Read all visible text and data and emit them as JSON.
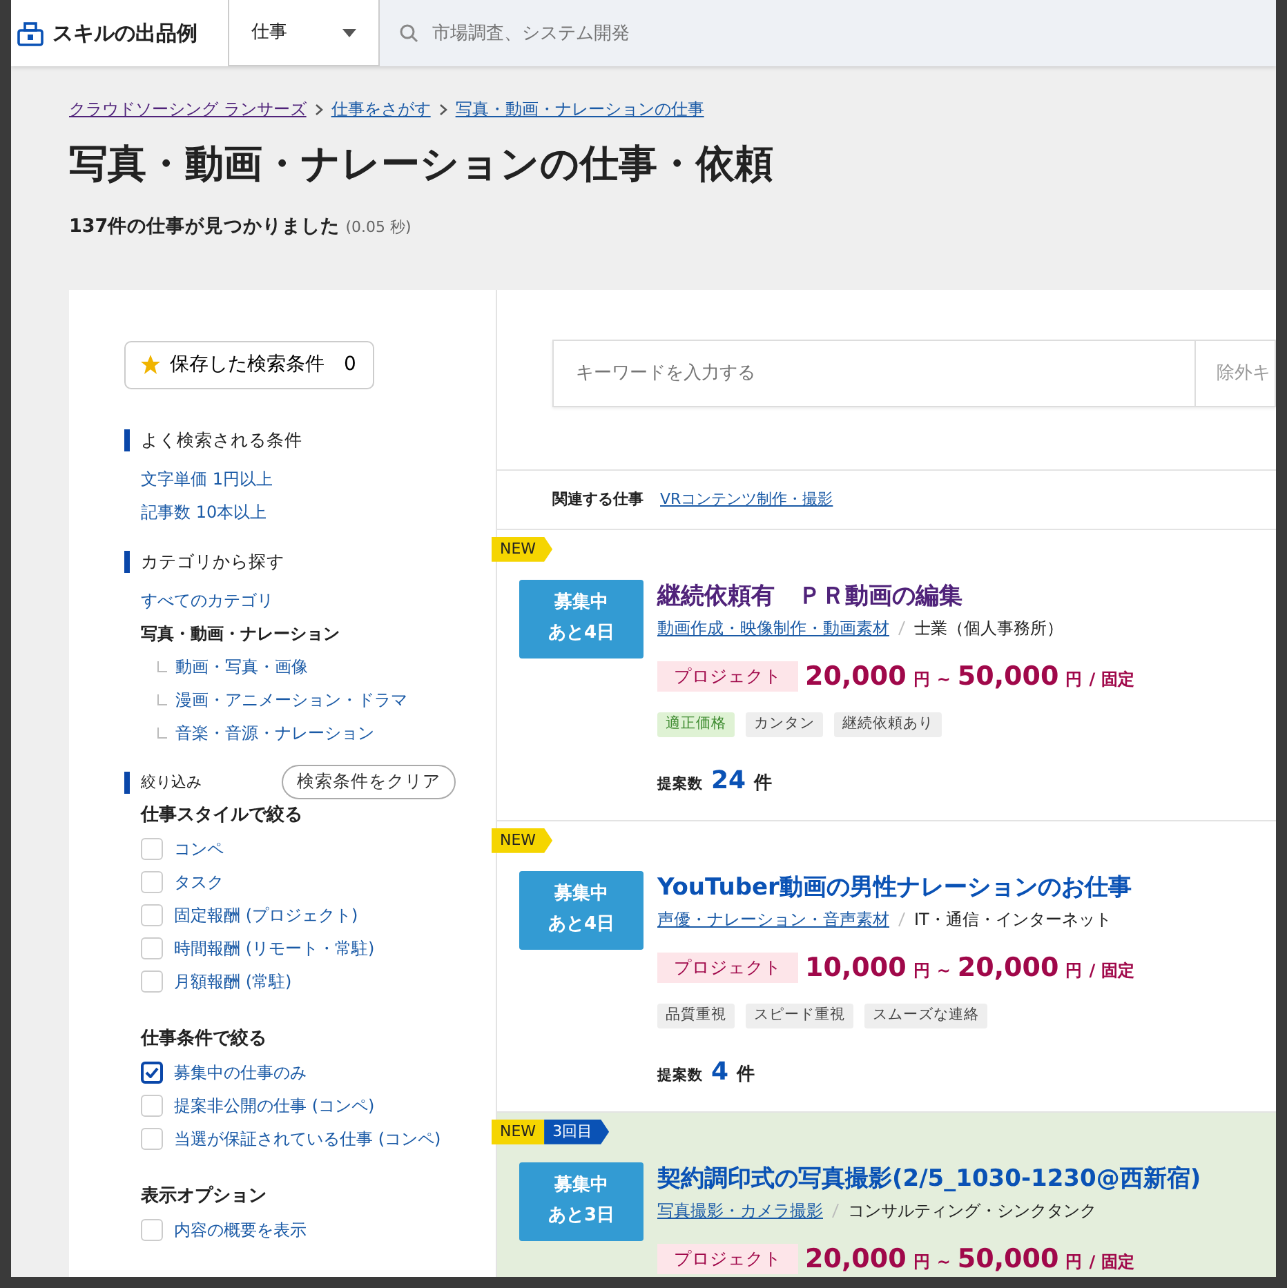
{
  "header": {
    "logo_text": "スキルの出品例",
    "category_select": "仕事",
    "search_placeholder": "市場調査、システム開発"
  },
  "breadcrumbs": [
    {
      "label": "クラウドソーシング ランサーズ",
      "visited": true
    },
    {
      "label": "仕事をさがす",
      "visited": false
    },
    {
      "label": "写真・動画・ナレーションの仕事",
      "visited": false
    }
  ],
  "title": "写真・動画・ナレーションの仕事・依頼",
  "result_count": "137件の仕事が見つかりました",
  "result_time": "(0.05 秒)",
  "sidebar": {
    "saved_search": {
      "label": "保存した検索条件",
      "count": "0"
    },
    "popular": {
      "heading": "よく検索される条件",
      "links": [
        "文字単価 1円以上",
        "記事数 10本以上"
      ]
    },
    "categories": {
      "heading": "カテゴリから探す",
      "all_link": "すべてのカテゴリ",
      "current": {
        "label": "写真・動画・ナレーション",
        "children": [
          {
            "label": "動画・写真・画像"
          },
          {
            "label": "漫画・アニメーション・ドラマ"
          },
          {
            "label": "音楽・音源・ナレーション"
          }
        ]
      }
    },
    "filters": {
      "heading": "絞り込み",
      "clear_button": "検索条件をクリア",
      "groups": [
        {
          "heading": "仕事スタイルで絞る",
          "options": [
            {
              "label": "コンペ",
              "checked": false
            },
            {
              "label": "タスク",
              "checked": false
            },
            {
              "label": "固定報酬 (プロジェクト)",
              "checked": false
            },
            {
              "label": "時間報酬 (リモート・常駐)",
              "checked": false
            },
            {
              "label": "月額報酬 (常駐)",
              "checked": false
            }
          ]
        },
        {
          "heading": "仕事条件で絞る",
          "options": [
            {
              "label": "募集中の仕事のみ",
              "checked": true
            },
            {
              "label": "提案非公開の仕事 (コンペ)",
              "checked": false
            },
            {
              "label": "当選が保証されている仕事 (コンペ)",
              "checked": false
            }
          ]
        },
        {
          "heading": "表示オプション",
          "options": [
            {
              "label": "内容の概要を表示",
              "checked": false
            }
          ]
        }
      ]
    }
  },
  "search": {
    "keyword_placeholder": "キーワードを入力する",
    "exclude_placeholder": "除外キ"
  },
  "related": {
    "label": "関連する仕事",
    "link": "VRコンテンツ制作・撮影"
  },
  "jobs": [
    {
      "highlighted": false,
      "badges": [
        {
          "kind": "new",
          "text": "NEW"
        }
      ],
      "status": "募集中",
      "remaining": "あと4日",
      "title": "継続依頼有　ＰＲ動画の編集",
      "visited": true,
      "category": "動画作成・映像制作・動画素材",
      "industry": "士業（個人事務所）",
      "type_label": "プロジェクト",
      "price_min": "20,000",
      "price_unit_1": "円",
      "price_sep": "~",
      "price_max": "50,000",
      "price_unit_2": "円",
      "price_suffix": "/ 固定",
      "tags": [
        {
          "kind": "good",
          "text": "適正価格"
        },
        {
          "kind": "plain",
          "text": "カンタン"
        },
        {
          "kind": "plain",
          "text": "継続依頼あり"
        }
      ],
      "proposals_label": "提案数",
      "proposals": "24",
      "proposals_unit": "件"
    },
    {
      "highlighted": false,
      "badges": [
        {
          "kind": "new",
          "text": "NEW"
        }
      ],
      "status": "募集中",
      "remaining": "あと4日",
      "title": "YouTuber動画の男性ナレーションのお仕事",
      "visited": false,
      "category": "声優・ナレーション・音声素材",
      "industry": "IT・通信・インターネット",
      "type_label": "プロジェクト",
      "price_min": "10,000",
      "price_unit_1": "円",
      "price_sep": "~",
      "price_max": "20,000",
      "price_unit_2": "円",
      "price_suffix": "/ 固定",
      "tags": [
        {
          "kind": "plain",
          "text": "品質重視"
        },
        {
          "kind": "plain",
          "text": "スピード重視"
        },
        {
          "kind": "plain",
          "text": "スムーズな連絡"
        }
      ],
      "proposals_label": "提案数",
      "proposals": "4",
      "proposals_unit": "件"
    },
    {
      "highlighted": true,
      "badges": [
        {
          "kind": "new",
          "text": "NEW"
        },
        {
          "kind": "count",
          "text": "3回目"
        }
      ],
      "status": "募集中",
      "remaining": "あと3日",
      "title": "契約調印式の写真撮影(2/5_1030-1230@西新宿)",
      "visited": false,
      "category": "写真撮影・カメラ撮影",
      "industry": "コンサルティング・シンクタンク",
      "type_label": "プロジェクト",
      "price_min": "20,000",
      "price_unit_1": "円",
      "price_sep": "~",
      "price_max": "50,000",
      "price_unit_2": "円",
      "price_suffix": "/ 固定"
    }
  ]
}
